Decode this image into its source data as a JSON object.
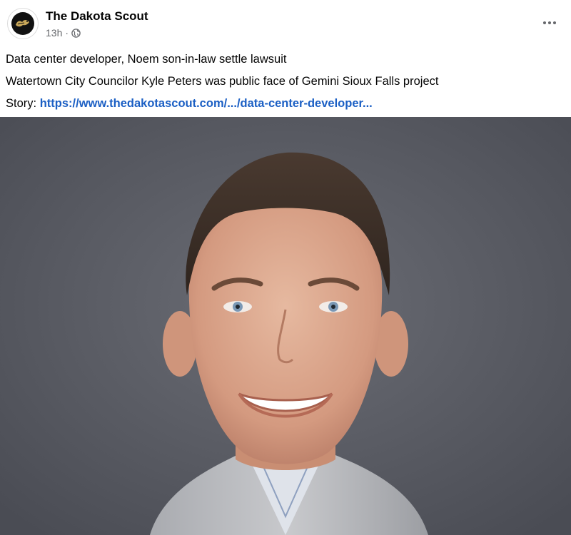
{
  "post": {
    "page_name": "The Dakota Scout",
    "timestamp": "13h",
    "separator": "·",
    "avatar_icon": "dakota-scout-logo-icon",
    "audience_icon": "globe-icon",
    "more_icon": "more-options-icon"
  },
  "body": {
    "line1": "Data center developer, Noem son-in-law settle lawsuit",
    "line2": "Watertown City Councilor Kyle Peters was public face of Gemini Sioux Falls project",
    "story_label": "Story:",
    "story_link": "https://www.thedakotascout.com/.../data-center-developer..."
  },
  "colors": {
    "link": "#1b5fc4",
    "meta": "#65676b",
    "photo_background": "#5c5e66"
  }
}
